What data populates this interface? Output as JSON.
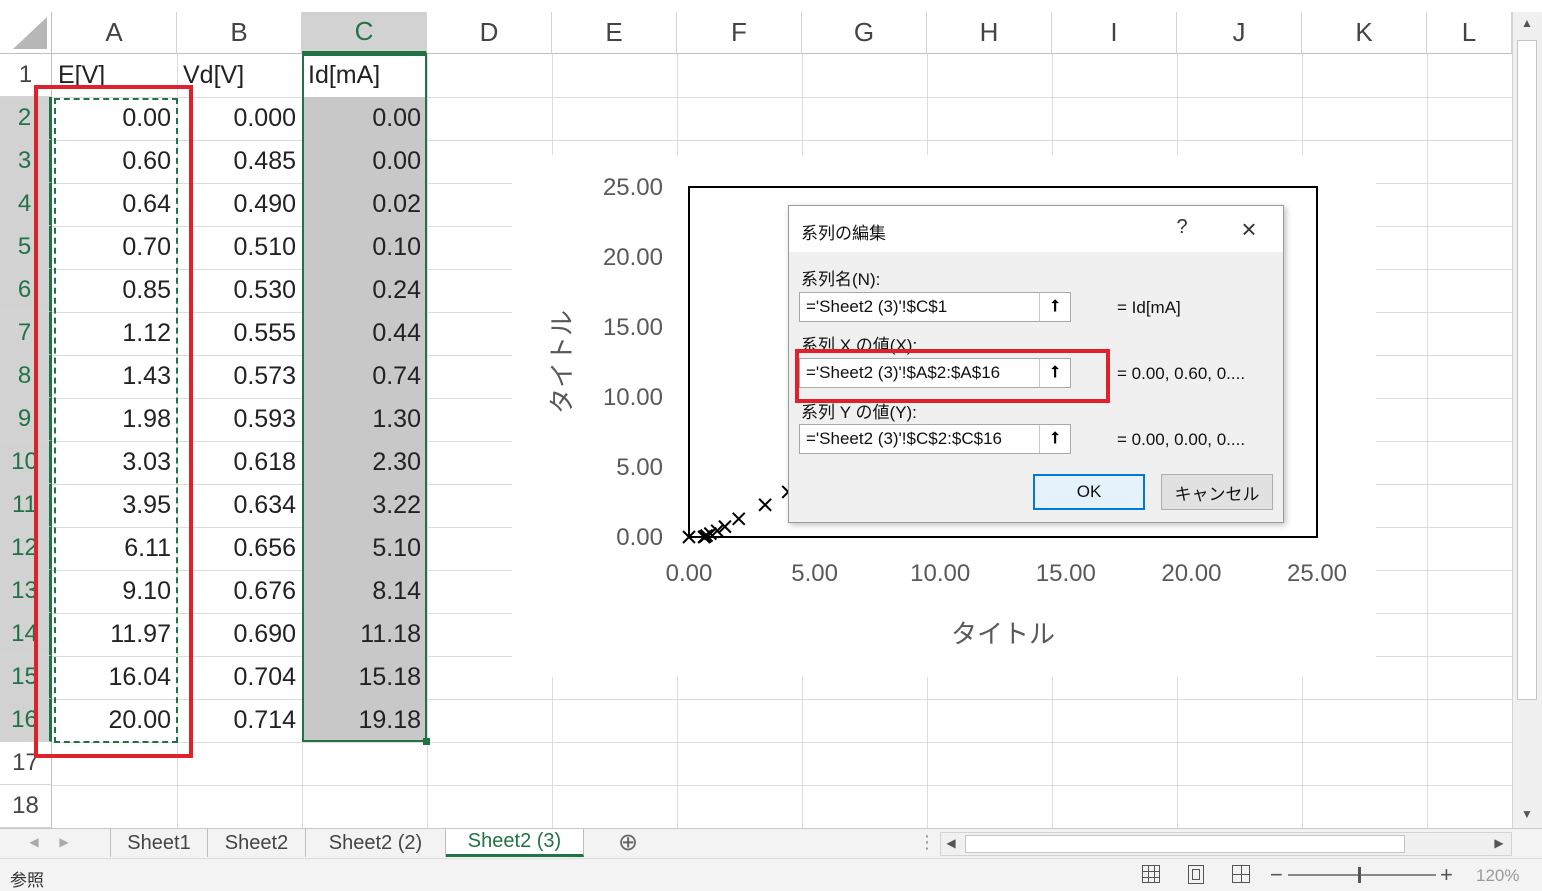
{
  "columns": [
    "A",
    "B",
    "C",
    "D",
    "E",
    "F",
    "G",
    "H",
    "I",
    "J",
    "K",
    "L"
  ],
  "rows": [
    "1",
    "2",
    "3",
    "4",
    "5",
    "6",
    "7",
    "8",
    "9",
    "10",
    "11",
    "12",
    "13",
    "14",
    "15",
    "16",
    "17",
    "18"
  ],
  "headers": {
    "a": "E[V]",
    "b": "Vd[V]",
    "c": "Id[mA]"
  },
  "table": [
    [
      "0.00",
      "0.000",
      "0.00"
    ],
    [
      "0.60",
      "0.485",
      "0.00"
    ],
    [
      "0.64",
      "0.490",
      "0.02"
    ],
    [
      "0.70",
      "0.510",
      "0.10"
    ],
    [
      "0.85",
      "0.530",
      "0.24"
    ],
    [
      "1.12",
      "0.555",
      "0.44"
    ],
    [
      "1.43",
      "0.573",
      "0.74"
    ],
    [
      "1.98",
      "0.593",
      "1.30"
    ],
    [
      "3.03",
      "0.618",
      "2.30"
    ],
    [
      "3.95",
      "0.634",
      "3.22"
    ],
    [
      "6.11",
      "0.656",
      "5.10"
    ],
    [
      "9.10",
      "0.676",
      "8.14"
    ],
    [
      "11.97",
      "0.690",
      "11.18"
    ],
    [
      "16.04",
      "0.704",
      "15.18"
    ],
    [
      "20.00",
      "0.714",
      "19.18"
    ]
  ],
  "chart_data": {
    "type": "scatter",
    "title": "",
    "xlabel": "タイトル",
    "ylabel": "タイトル",
    "xlim": [
      0,
      25
    ],
    "ylim": [
      0,
      25
    ],
    "xticks": [
      "0.00",
      "5.00",
      "10.00",
      "15.00",
      "20.00",
      "25.00"
    ],
    "yticks": [
      "0.00",
      "5.00",
      "10.00",
      "15.00",
      "20.00",
      "25.00"
    ],
    "x": [
      0.0,
      0.6,
      0.64,
      0.7,
      0.85,
      1.12,
      1.43,
      1.98,
      3.03,
      3.95,
      6.11,
      9.1,
      11.97,
      16.04,
      20.0
    ],
    "y": [
      0.0,
      0.0,
      0.02,
      0.1,
      0.24,
      0.44,
      0.74,
      1.3,
      2.3,
      3.22,
      5.1,
      8.14,
      11.18,
      15.18,
      19.18
    ],
    "marker": "x",
    "grid": false
  },
  "dialog": {
    "title": "系列の編集",
    "help": "?",
    "close": "×",
    "name_label": "系列名(N):",
    "name_value": "='Sheet2 (3)'!$C$1",
    "name_result": "= Id[mA]",
    "x_label": "系列 X の値(X):",
    "x_value": "='Sheet2 (3)'!$A$2:$A$16",
    "x_result": "= 0.00, 0.60, 0....",
    "y_label": "系列 Y の値(Y):",
    "y_value": "='Sheet2 (3)'!$C$2:$C$16",
    "y_result": "= 0.00, 0.00, 0....",
    "ok": "OK",
    "cancel": "キャンセル",
    "range_icon": "⭡"
  },
  "tabs": [
    "Sheet1",
    "Sheet2",
    "Sheet2 (2)",
    "Sheet2 (3)"
  ],
  "active_tab": "Sheet2 (3)",
  "add_sheet": "⊕",
  "status": {
    "mode": "参照",
    "zoom": "120%",
    "zoom_minus": "−",
    "zoom_plus": "+"
  },
  "colors": {
    "excel_green": "#217346",
    "highlight_red": "#e0202a",
    "selected_gray": "#c8c8c8"
  }
}
